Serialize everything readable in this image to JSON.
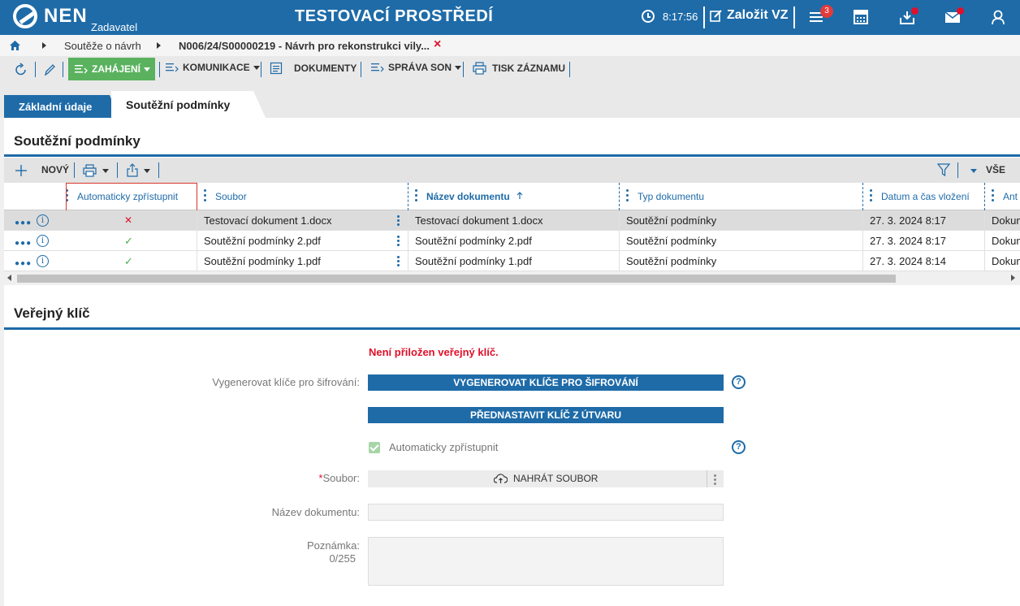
{
  "header": {
    "logo_text": "NEN",
    "logo_sub": "Zadavatel",
    "environment": "TESTOVACÍ PROSTŘEDÍ",
    "time": "8:17:56",
    "create_label": "Založit VZ",
    "notification_count": "3"
  },
  "breadcrumb": {
    "item1": "Soutěže o návrh",
    "item2": "N006/24/S00000219 - Návrh pro rekonstrukci vily...",
    "close": "×"
  },
  "toolbar": {
    "zahajeni": "ZAHÁJENÍ",
    "komunikace": "KOMUNIKACE",
    "dokumenty": "DOKUMENTY",
    "sprava_son": "SPRÁVA SON",
    "tisk": "TISK ZÁZNAMU"
  },
  "tabs": {
    "basic": "Základní údaje",
    "conditions": "Soutěžní podmínky"
  },
  "conditions": {
    "title": "Soutěžní podmínky",
    "new_label": "NOVÝ",
    "filter_label": "VŠE",
    "columns": {
      "auto": "Automaticky zpřístupnit",
      "file": "Soubor",
      "name": "Název dokumentu",
      "type": "Typ dokumentu",
      "date": "Datum a čas vložení",
      "extra": "Ant"
    },
    "rows": [
      {
        "auto": "✕",
        "file": "Testovací dokument 1.docx",
        "name": "Testovací dokument 1.docx",
        "type": "Soutěžní podmínky",
        "date": "27. 3. 2024 8:17",
        "extra": "Dokum"
      },
      {
        "auto": "✓",
        "file": "Soutěžní podmínky 2.pdf",
        "name": "Soutěžní podmínky 2.pdf",
        "type": "Soutěžní podmínky",
        "date": "27. 3. 2024 8:17",
        "extra": "Dokum"
      },
      {
        "auto": "✓",
        "file": "Soutěžní podmínky 1.pdf",
        "name": "Soutěžní podmínky 1.pdf",
        "type": "Soutěžní podmínky",
        "date": "27. 3. 2024 8:14",
        "extra": "Dokum"
      }
    ]
  },
  "public_key": {
    "title": "Veřejný klíč",
    "warning": "Není přiložen veřejný klíč.",
    "generate_label": "Vygenerovat klíče pro šifrování:",
    "generate_button": "VYGENEROVAT KLÍČE PRO ŠIFROVÁNÍ",
    "preset_button": "PŘEDNASTAVIT KLÍČ Z ÚTVARU",
    "auto_label": "Automaticky zpřístupnit",
    "file_label": "Soubor:",
    "upload_button": "NAHRÁT SOUBOR",
    "docname_label": "Název dokumentu:",
    "note_label": "Poznámka:",
    "note_counter": "0/255"
  },
  "colors": {
    "brand": "#1e6ba8",
    "green": "#5ab25e",
    "error": "#e0102a"
  }
}
